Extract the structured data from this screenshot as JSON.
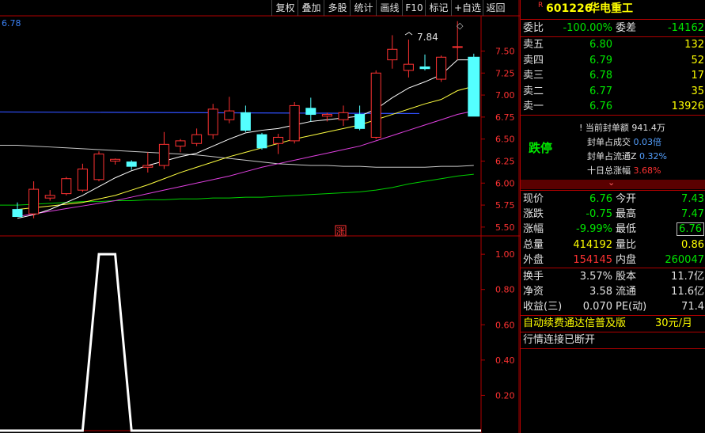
{
  "toolbar": {
    "buttons": [
      "复权",
      "叠加",
      "多股",
      "统计",
      "画线",
      "F10",
      "标记",
      "+自选",
      "返回"
    ]
  },
  "main_chart": {
    "corner_value": "6.78",
    "high_marker": "7.84",
    "limit_up_tag": "涨",
    "y_ticks": [
      "7.50",
      "7.25",
      "7.00",
      "6.75",
      "6.50",
      "6.25",
      "6.00",
      "5.75",
      "5.50"
    ]
  },
  "indicator": {
    "y_ticks": [
      "1.00",
      "0.80",
      "0.60",
      "0.40",
      "0.20"
    ]
  },
  "chart_data": [
    {
      "type": "candlestick",
      "ylim": [
        5.4,
        7.9
      ],
      "candles": [
        {
          "o": 5.7,
          "h": 5.78,
          "l": 5.62,
          "c": 5.62
        },
        {
          "o": 5.65,
          "h": 6.02,
          "l": 5.6,
          "c": 5.93
        },
        {
          "o": 5.83,
          "h": 5.92,
          "l": 5.8,
          "c": 5.86
        },
        {
          "o": 5.88,
          "h": 6.07,
          "l": 5.86,
          "c": 6.05
        },
        {
          "o": 5.92,
          "h": 6.22,
          "l": 5.9,
          "c": 6.16
        },
        {
          "o": 6.04,
          "h": 6.36,
          "l": 6.02,
          "c": 6.33
        },
        {
          "o": 6.25,
          "h": 6.28,
          "l": 6.21,
          "c": 6.27
        },
        {
          "o": 6.24,
          "h": 6.26,
          "l": 6.15,
          "c": 6.19
        },
        {
          "o": 6.18,
          "h": 6.35,
          "l": 6.12,
          "c": 6.2
        },
        {
          "o": 6.2,
          "h": 6.58,
          "l": 6.16,
          "c": 6.44
        },
        {
          "o": 6.42,
          "h": 6.5,
          "l": 6.35,
          "c": 6.48
        },
        {
          "o": 6.45,
          "h": 6.62,
          "l": 6.42,
          "c": 6.55
        },
        {
          "o": 6.55,
          "h": 6.9,
          "l": 6.5,
          "c": 6.84
        },
        {
          "o": 6.72,
          "h": 6.98,
          "l": 6.68,
          "c": 6.82
        },
        {
          "o": 6.8,
          "h": 6.88,
          "l": 6.58,
          "c": 6.6
        },
        {
          "o": 6.55,
          "h": 6.57,
          "l": 6.38,
          "c": 6.4
        },
        {
          "o": 6.45,
          "h": 6.56,
          "l": 6.33,
          "c": 6.52
        },
        {
          "o": 6.48,
          "h": 6.92,
          "l": 6.45,
          "c": 6.88
        },
        {
          "o": 6.85,
          "h": 6.97,
          "l": 6.7,
          "c": 6.78
        },
        {
          "o": 6.76,
          "h": 6.8,
          "l": 6.7,
          "c": 6.78
        },
        {
          "o": 6.72,
          "h": 6.88,
          "l": 6.65,
          "c": 6.8
        },
        {
          "o": 6.78,
          "h": 6.88,
          "l": 6.6,
          "c": 6.62
        },
        {
          "o": 6.52,
          "h": 7.28,
          "l": 6.5,
          "c": 7.25
        },
        {
          "o": 7.4,
          "h": 7.68,
          "l": 7.3,
          "c": 7.52
        },
        {
          "o": 7.28,
          "h": 7.63,
          "l": 7.2,
          "c": 7.35
        },
        {
          "o": 7.32,
          "h": 7.46,
          "l": 7.28,
          "c": 7.3
        },
        {
          "o": 7.18,
          "h": 7.45,
          "l": 7.15,
          "c": 7.43
        },
        {
          "o": 7.55,
          "h": 7.84,
          "l": 7.4,
          "c": 7.55
        },
        {
          "o": 7.43,
          "h": 7.47,
          "l": 6.76,
          "c": 6.76
        }
      ],
      "ma_white": [
        5.6,
        5.64,
        5.7,
        5.78,
        5.86,
        5.96,
        6.06,
        6.14,
        6.2,
        6.25,
        6.3,
        6.34,
        6.42,
        6.5,
        6.57,
        6.6,
        6.62,
        6.66,
        6.7,
        6.72,
        6.74,
        6.76,
        6.84,
        6.97,
        7.08,
        7.15,
        7.23,
        7.4,
        7.4
      ],
      "ma_yellow": [
        5.7,
        5.72,
        5.74,
        5.76,
        5.78,
        5.82,
        5.86,
        5.92,
        5.98,
        6.05,
        6.12,
        6.18,
        6.24,
        6.3,
        6.35,
        6.4,
        6.45,
        6.5,
        6.54,
        6.58,
        6.62,
        6.66,
        6.72,
        6.78,
        6.84,
        6.9,
        6.95,
        7.05,
        7.1
      ],
      "ma_magenta": [
        5.62,
        5.65,
        5.68,
        5.71,
        5.74,
        5.77,
        5.8,
        5.84,
        5.88,
        5.92,
        5.96,
        6.0,
        6.04,
        6.08,
        6.13,
        6.18,
        6.22,
        6.26,
        6.3,
        6.34,
        6.38,
        6.42,
        6.48,
        6.54,
        6.6,
        6.66,
        6.72,
        6.78,
        6.82
      ],
      "ma_gray": [
        6.43,
        6.42,
        6.41,
        6.4,
        6.39,
        6.38,
        6.37,
        6.36,
        6.35,
        6.34,
        6.33,
        6.32,
        6.3,
        6.28,
        6.26,
        6.24,
        6.22,
        6.21,
        6.2,
        6.2,
        6.19,
        6.19,
        6.18,
        6.18,
        6.18,
        6.18,
        6.19,
        6.19,
        6.2
      ],
      "ma_green": [
        5.75,
        5.76,
        5.77,
        5.78,
        5.79,
        5.79,
        5.8,
        5.8,
        5.81,
        5.81,
        5.82,
        5.82,
        5.83,
        5.83,
        5.84,
        5.84,
        5.85,
        5.86,
        5.87,
        5.88,
        5.89,
        5.9,
        5.92,
        5.95,
        5.99,
        6.02,
        6.05,
        6.08,
        6.1
      ],
      "ma_blue_level": 6.79
    },
    {
      "type": "line",
      "ylim": [
        0,
        1.05
      ],
      "values": [
        0,
        0,
        0,
        0,
        0,
        1,
        1,
        0,
        0,
        0,
        0,
        0,
        0,
        0,
        0,
        0,
        0,
        0,
        0,
        0,
        0,
        0,
        0,
        0,
        0,
        0,
        0,
        0,
        0
      ]
    }
  ],
  "quote": {
    "code": "601226",
    "name": "华电重工",
    "r_mark": "R",
    "order_ratio_label": "委比",
    "order_ratio": "-100.00%",
    "order_diff_label": "委差",
    "order_diff": "-14162",
    "asks": [
      {
        "label": "卖五",
        "price": "6.80",
        "vol": "132"
      },
      {
        "label": "卖四",
        "price": "6.79",
        "vol": "52"
      },
      {
        "label": "卖三",
        "price": "6.78",
        "vol": "17"
      },
      {
        "label": "卖二",
        "price": "6.77",
        "vol": "35"
      },
      {
        "label": "卖一",
        "price": "6.76",
        "vol": "13926"
      }
    ],
    "limit_status": "跌停",
    "seal": [
      {
        "label": "当前封单额",
        "value": "941.4万"
      },
      {
        "label": "封单占成交",
        "value": "0.03倍"
      },
      {
        "label": "封单占流通Z",
        "value": "0.32%"
      },
      {
        "label": "十日总涨幅",
        "value": "3.68%"
      }
    ],
    "stats": [
      {
        "l1": "现价",
        "v1": "6.76",
        "l2": "今开",
        "v2": "7.43"
      },
      {
        "l1": "涨跌",
        "v1": "-0.75",
        "l2": "最高",
        "v2": "7.47"
      },
      {
        "l1": "涨幅",
        "v1": "-9.99%",
        "l2": "最低",
        "v2": "6.76"
      },
      {
        "l1": "总量",
        "v1": "414192",
        "l2": "量比",
        "v2": "0.86"
      },
      {
        "l1": "外盘",
        "v1": "154145",
        "l2": "内盘",
        "v2": "260047"
      }
    ],
    "fund": [
      {
        "l1": "换手",
        "v1": "3.57%",
        "l2": "股本",
        "v2": "11.7亿"
      },
      {
        "l1": "净资",
        "v1": "3.58",
        "l2": "流通",
        "v2": "11.6亿"
      },
      {
        "l1": "收益(三)",
        "v1": "0.070",
        "l2": "PE(动)",
        "v2": "71.4"
      }
    ],
    "promo_text": "自动续费通达信普及版",
    "promo_price": "30元/月",
    "status_text": "行情连接已断开"
  },
  "colors": {
    "up": "#ff3232",
    "down": "#54ffff",
    "green": "#00e600",
    "yellow": "#ffff00",
    "border": "#b00000"
  }
}
